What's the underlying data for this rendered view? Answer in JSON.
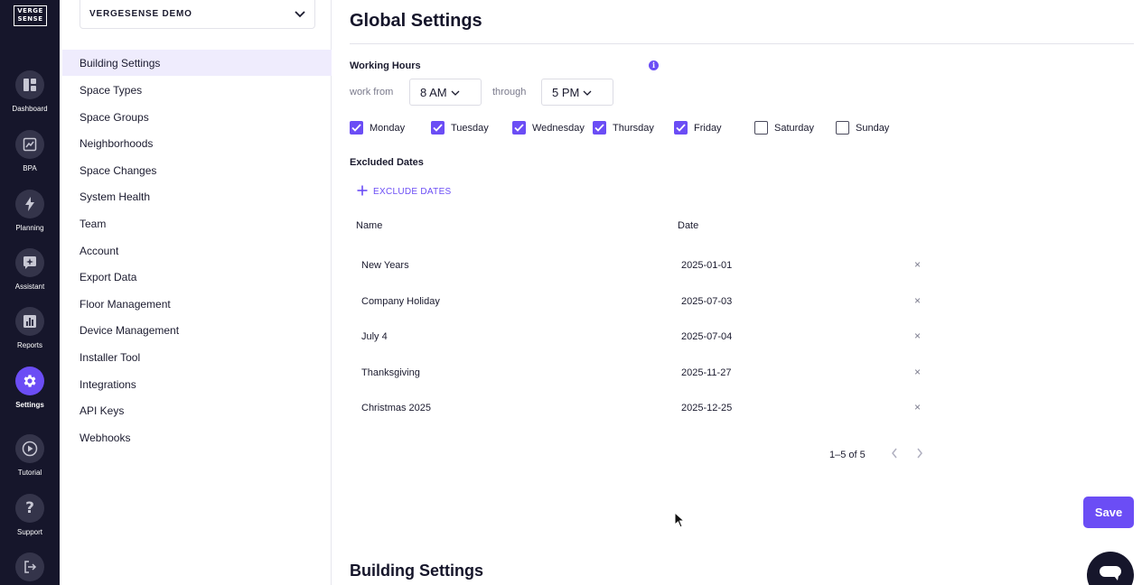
{
  "logo": {
    "line1": "VERGE",
    "line2": "SENSE"
  },
  "rail": [
    {
      "label": "Dashboard",
      "icon": "dashboard-icon"
    },
    {
      "label": "BPA",
      "icon": "chart-icon"
    },
    {
      "label": "Planning",
      "icon": "bolt-icon"
    },
    {
      "label": "Assistant",
      "icon": "sparkle-chat-icon"
    },
    {
      "label": "Reports",
      "icon": "bar-chart-icon"
    },
    {
      "label": "Settings",
      "icon": "gear-icon",
      "active": true
    },
    {
      "label": "Tutorial",
      "icon": "play-icon"
    },
    {
      "label": "Support",
      "icon": "question-icon"
    },
    {
      "label": "",
      "icon": "logout-icon"
    }
  ],
  "building_select": {
    "value": "VERGESENSE DEMO"
  },
  "sidebar": {
    "items": [
      "Building Settings",
      "Space Types",
      "Space Groups",
      "Neighborhoods",
      "Space Changes",
      "System Health",
      "Team",
      "Account",
      "Export Data",
      "Floor Management",
      "Device Management",
      "Installer Tool",
      "Integrations",
      "API Keys",
      "Webhooks"
    ],
    "active": "Building Settings"
  },
  "main": {
    "title": "Global Settings",
    "working_hours": {
      "label": "Working Hours",
      "from_label": "work from",
      "from_value": "8 AM",
      "through_label": "through",
      "through_value": "5 PM"
    },
    "days": [
      {
        "label": "Monday",
        "checked": true
      },
      {
        "label": "Tuesday",
        "checked": true
      },
      {
        "label": "Wednesday",
        "checked": true
      },
      {
        "label": "Thursday",
        "checked": true
      },
      {
        "label": "Friday",
        "checked": true
      },
      {
        "label": "Saturday",
        "checked": false
      },
      {
        "label": "Sunday",
        "checked": false
      }
    ],
    "excluded": {
      "label": "Excluded Dates",
      "add_label": "EXCLUDE DATES",
      "columns": {
        "name": "Name",
        "date": "Date"
      },
      "rows": [
        {
          "name": "New Years",
          "date": "2025-01-01"
        },
        {
          "name": "Company Holiday",
          "date": "2025-07-03"
        },
        {
          "name": "July 4",
          "date": "2025-07-04"
        },
        {
          "name": "Thanksgiving",
          "date": "2025-11-27"
        },
        {
          "name": "Christmas 2025",
          "date": "2025-12-25"
        }
      ],
      "pagination": "1–5 of 5"
    },
    "save_label": "Save",
    "next_section_title": "Building Settings"
  },
  "colors": {
    "accent": "#6b4df5",
    "rail_bg": "#16162b",
    "active_bg": "#efecfd"
  }
}
